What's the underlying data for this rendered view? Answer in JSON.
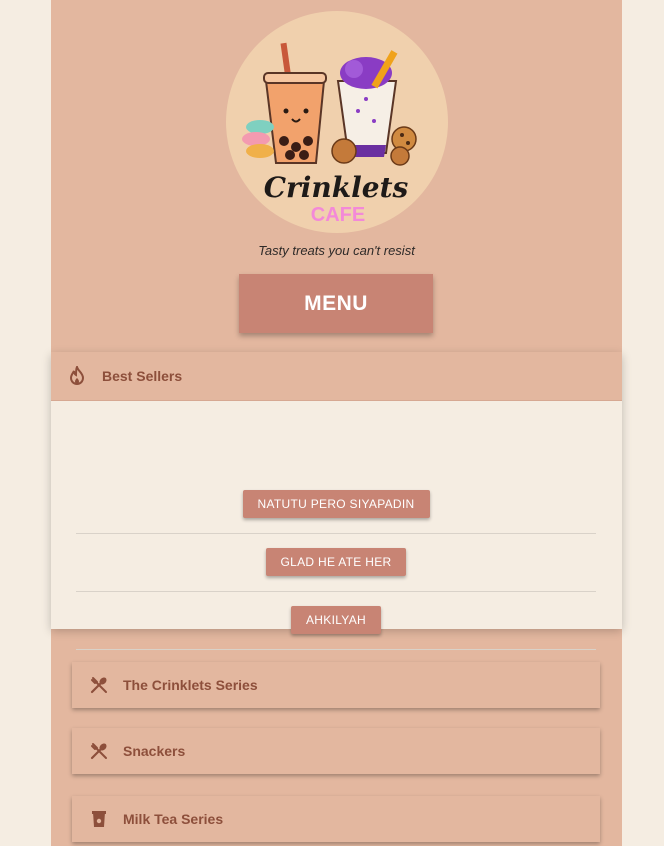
{
  "brand": {
    "name": "Crinklets",
    "sub": "CAFE",
    "tagline": "Tasty treats you can't resist"
  },
  "menu_button": {
    "label": "MENU"
  },
  "best_sellers": {
    "label": "Best Sellers",
    "icon": "fire-icon",
    "items": [
      {
        "label": "NATUTU PERO SIYAPADIN"
      },
      {
        "label": "GLAD HE ATE HER"
      },
      {
        "label": "AHKILYAH"
      }
    ]
  },
  "categories": [
    {
      "label": "The Crinklets Series",
      "icon": "utensils-icon"
    },
    {
      "label": "Snackers",
      "icon": "utensils-icon"
    },
    {
      "label": "Milk Tea Series",
      "icon": "cup-icon"
    }
  ],
  "colors": {
    "page_bg": "#f5ede2",
    "panel": "#e3b79f",
    "button": "#c88474",
    "label_text": "#8d4f3b",
    "logo_bg": "#f0d0ad"
  }
}
